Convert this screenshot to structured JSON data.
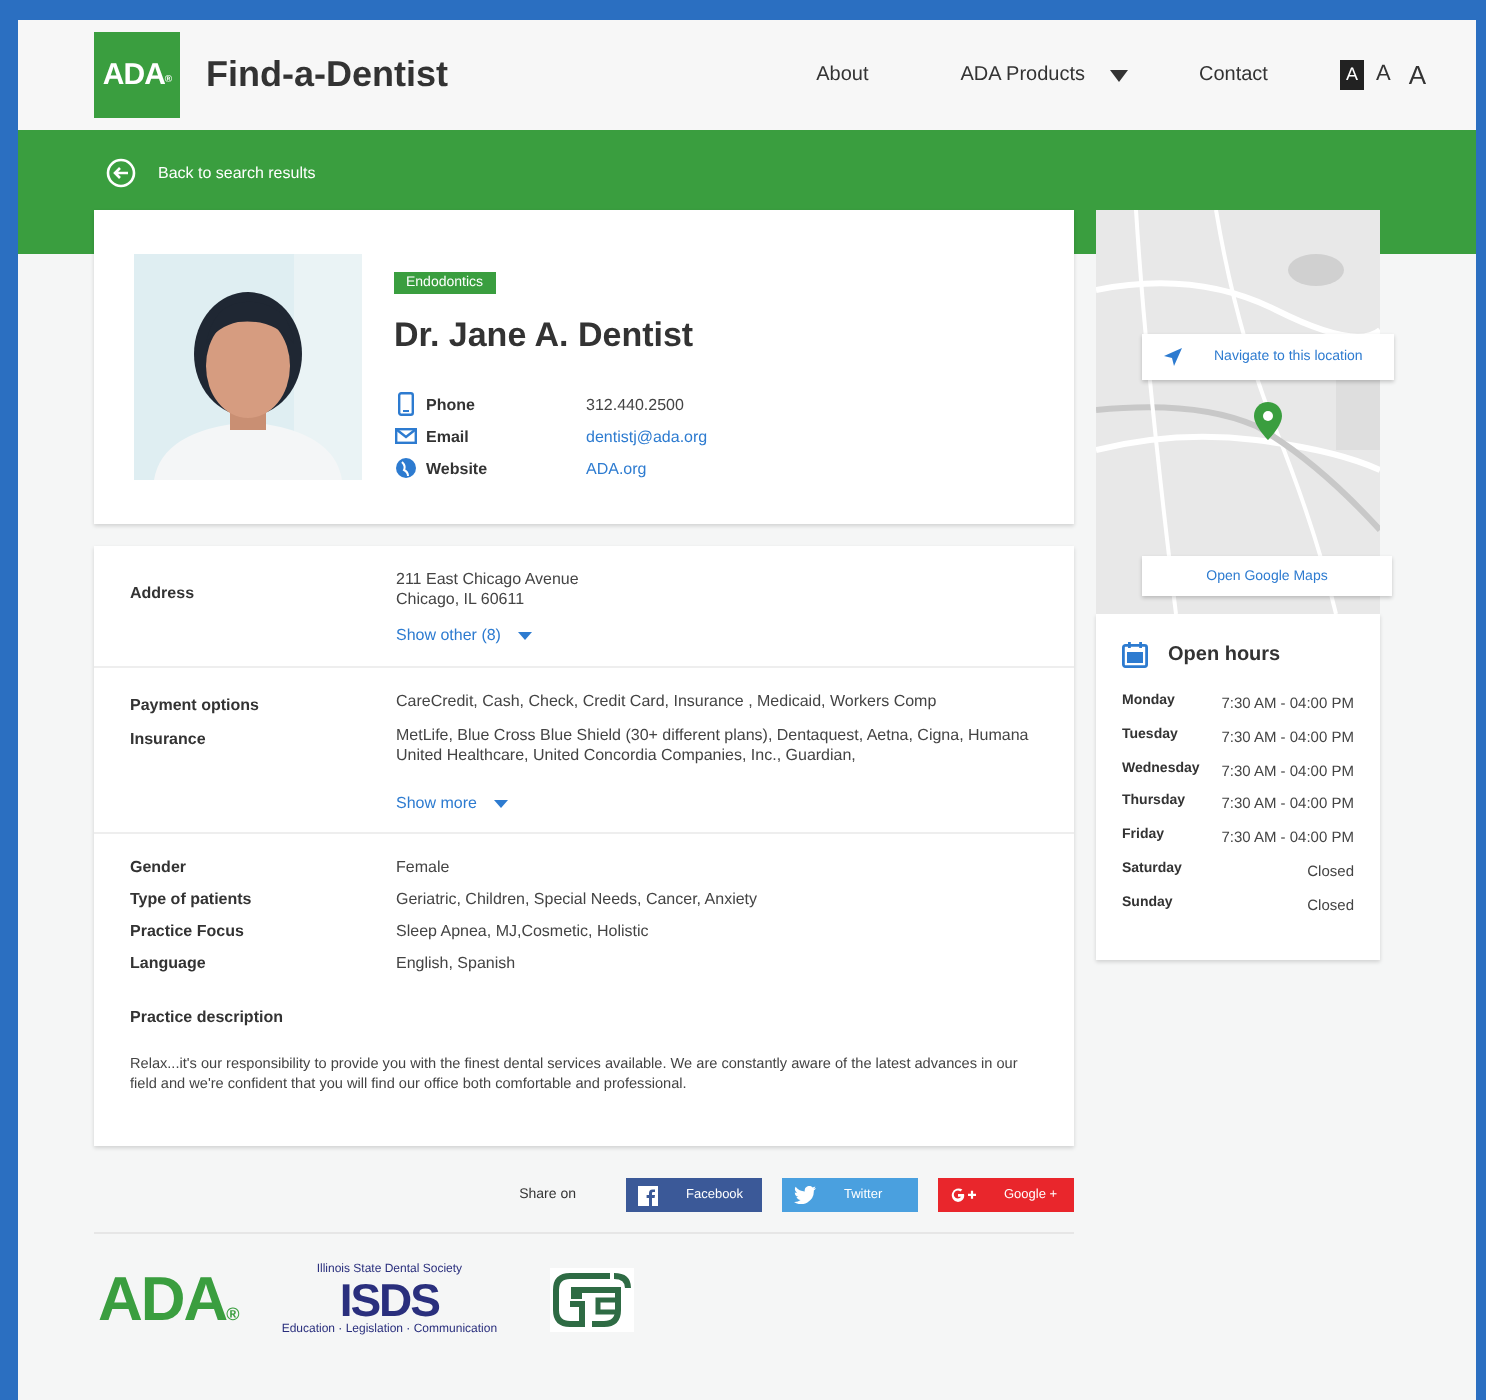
{
  "header": {
    "logo": {
      "text": "ADA",
      "mark": "®"
    },
    "title": "Find-a-Dentist",
    "nav": [
      {
        "label": "About",
        "dropdown": false
      },
      {
        "label": "ADA Products",
        "dropdown": true
      },
      {
        "label": "Contact",
        "dropdown": false
      }
    ],
    "font_sizes": [
      {
        "label": "A",
        "selected": true
      },
      {
        "label": "A",
        "selected": false
      },
      {
        "label": "A",
        "selected": false
      }
    ]
  },
  "back_link": "Back to search results",
  "profile": {
    "specialty": "Endodontics",
    "name": "Dr. Jane A. Dentist",
    "contacts": [
      {
        "kind": "phone",
        "label": "Phone",
        "value": "312.440.2500",
        "link": false
      },
      {
        "kind": "email",
        "label": "Email",
        "value": "dentistj@ada.org",
        "link": true
      },
      {
        "kind": "website",
        "label": "Website",
        "value": "ADA.org",
        "link": true
      }
    ]
  },
  "address": {
    "label": "Address",
    "lines": [
      "211 East Chicago Avenue",
      "Chicago, IL 60611"
    ],
    "toggle": "Show other (8)"
  },
  "payment": {
    "rows": [
      {
        "label": "Payment options",
        "value": "CareCredit, Cash, Check, Credit Card, Insurance , Medicaid, Workers Comp"
      },
      {
        "label": "Insurance",
        "value": "MetLife, Blue Cross Blue Shield (30+ different plans), Dentaquest, Aetna, Cigna, Humana United Healthcare, United Concordia Companies, Inc., Guardian,"
      }
    ],
    "toggle": "Show more"
  },
  "details": [
    {
      "label": "Gender",
      "value": "Female"
    },
    {
      "label": "Type of patients",
      "value": "Geriatric, Children, Special Needs, Cancer, Anxiety"
    },
    {
      "label": "Practice Focus",
      "value": "Sleep Apnea, MJ,Cosmetic, Holistic"
    },
    {
      "label": "Language",
      "value": "English, Spanish"
    }
  ],
  "description": {
    "label": "Practice description",
    "text": "Relax...it's our responsibility to provide you with the finest dental services available. We are constantly aware of the latest advances in our field and we're confident that you will find our office both comfortable and professional."
  },
  "share": {
    "label": "Share on",
    "buttons": [
      {
        "kind": "facebook",
        "label": "Facebook"
      },
      {
        "kind": "twitter",
        "label": "Twitter"
      },
      {
        "kind": "google",
        "label": "Google +"
      }
    ]
  },
  "map": {
    "navigate": "Navigate to this location",
    "open": "Open Google Maps"
  },
  "hours": {
    "title": "Open hours",
    "days": [
      {
        "day": "Monday",
        "time": "7:30 AM - 04:00 PM"
      },
      {
        "day": "Tuesday",
        "time": "7:30 AM - 04:00 PM"
      },
      {
        "day": "Wednesday",
        "time": "7:30 AM - 04:00 PM"
      },
      {
        "day": "Thursday",
        "time": "7:30 AM - 04:00 PM"
      },
      {
        "day": "Friday",
        "time": "7:30 AM - 04:00 PM"
      },
      {
        "day": "Saturday",
        "time": "Closed"
      },
      {
        "day": "Sunday",
        "time": "Closed"
      }
    ]
  },
  "footer_logos": [
    {
      "kind": "ada",
      "text": "ADA",
      "mark": "®"
    },
    {
      "kind": "isds",
      "top": "Illinois State Dental Society",
      "text": "ISDS",
      "bottom": "Education · Legislation · Communication"
    },
    {
      "kind": "emblem"
    }
  ]
}
